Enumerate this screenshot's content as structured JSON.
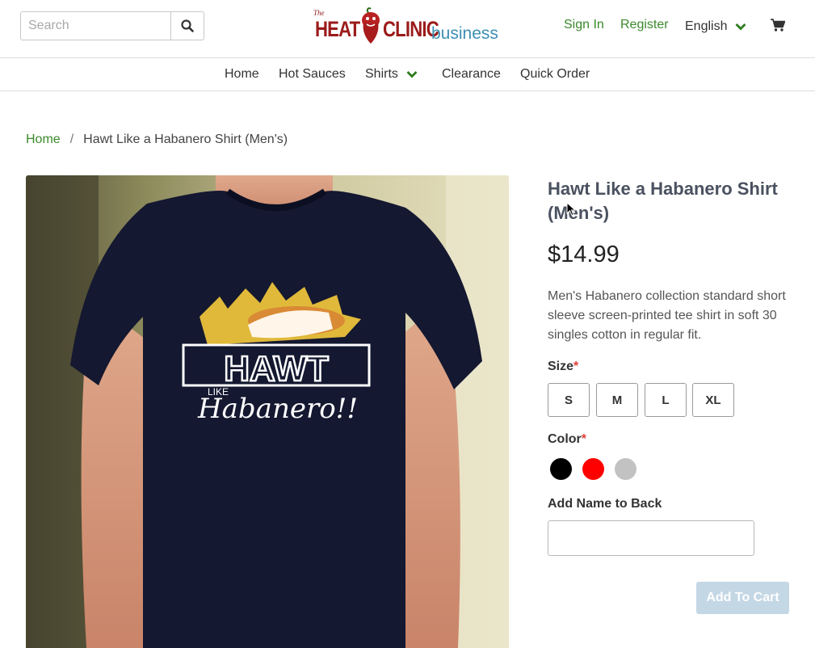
{
  "header": {
    "search_placeholder": "Search",
    "logo": {
      "small": "The",
      "heat": "HEAT",
      "clinic": "CLINIC",
      "business": "business"
    },
    "sign_in": "Sign In",
    "register": "Register",
    "language": "English"
  },
  "nav": {
    "items": [
      {
        "label": "Home"
      },
      {
        "label": "Hot Sauces"
      },
      {
        "label": "Shirts"
      },
      {
        "label": "Clearance"
      },
      {
        "label": "Quick Order"
      }
    ]
  },
  "breadcrumb": {
    "home": "Home",
    "separator": "/",
    "current": "Hawt Like a Habanero Shirt (Men's)"
  },
  "product": {
    "title": "Hawt Like a Habanero Shirt (Men's)",
    "price": "$14.99",
    "description": "Men's Habanero collection standard short sleeve screen-printed tee shirt in soft 30 singles cotton in regular fit.",
    "image_print": {
      "big": "HAWT",
      "like": "LIKE",
      "script": "Habanero!!"
    },
    "size_label": "Size",
    "required_mark": "*",
    "sizes": [
      "S",
      "M",
      "L",
      "XL"
    ],
    "color_label": "Color",
    "colors": [
      {
        "name": "black",
        "hex": "#000000"
      },
      {
        "name": "red",
        "hex": "#ff0000"
      },
      {
        "name": "gray",
        "hex": "#c2c2c2"
      }
    ],
    "name_label": "Add Name to Back",
    "name_value": "",
    "add_to_cart": "Add To Cart"
  },
  "colors": {
    "link_green": "#3a8a2a",
    "logo_red": "#9b1b1b",
    "logo_blue": "#3c8fb4",
    "button_disabled": "#c4d7e5"
  }
}
